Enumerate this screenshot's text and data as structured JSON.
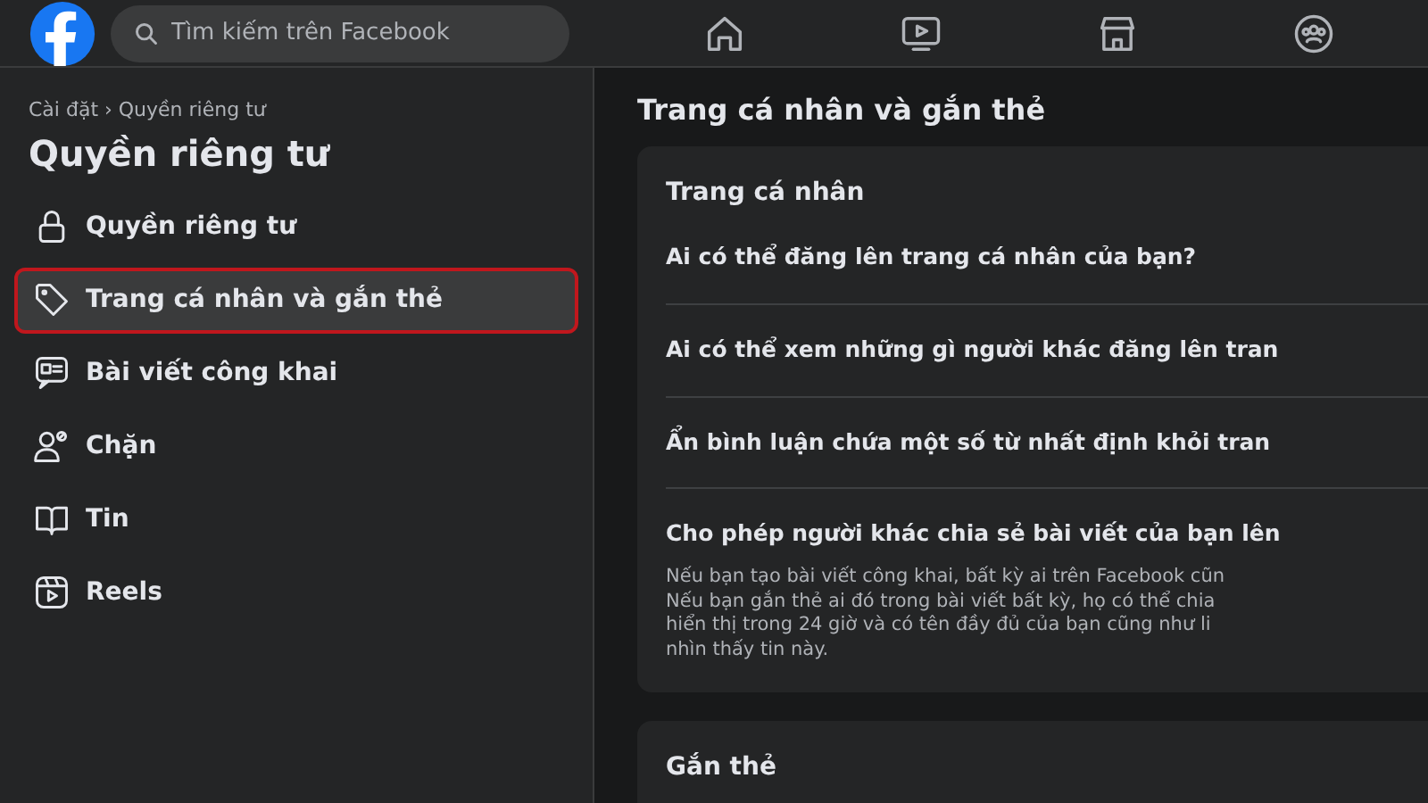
{
  "topbar": {
    "search": {
      "placeholder": "Tìm kiếm trên Facebook"
    }
  },
  "sidebar": {
    "breadcrumb": "Cài đặt › Quyền riêng tư",
    "title": "Quyền riêng tư",
    "items": [
      {
        "label": "Quyền riêng tư",
        "selected": false
      },
      {
        "label": "Trang cá nhân và gắn thẻ",
        "selected": true
      },
      {
        "label": "Bài viết công khai",
        "selected": false
      },
      {
        "label": "Chặn",
        "selected": false
      },
      {
        "label": "Tin",
        "selected": false
      },
      {
        "label": "Reels",
        "selected": false
      }
    ]
  },
  "main": {
    "title": "Trang cá nhân và gắn thẻ",
    "sections": [
      {
        "title": "Trang cá nhân",
        "rows": [
          {
            "label": "Ai có thể đăng lên trang cá nhân của bạn?"
          },
          {
            "label": "Ai có thể xem những gì người khác đăng lên tran"
          },
          {
            "label": "Ẩn bình luận chứa một số từ nhất định khỏi tran"
          },
          {
            "label": "Cho phép người khác chia sẻ bài viết của bạn lên",
            "description_lines": [
              "Nếu bạn tạo bài viết công khai, bất kỳ ai trên Facebook cũn",
              "Nếu bạn gắn thẻ ai đó trong bài viết bất kỳ, họ có thể chia",
              "hiển thị trong 24 giờ và có tên đầy đủ của bạn cũng như li",
              "nhìn thấy tin này."
            ]
          }
        ]
      },
      {
        "title": "Gắn thẻ"
      }
    ]
  }
}
